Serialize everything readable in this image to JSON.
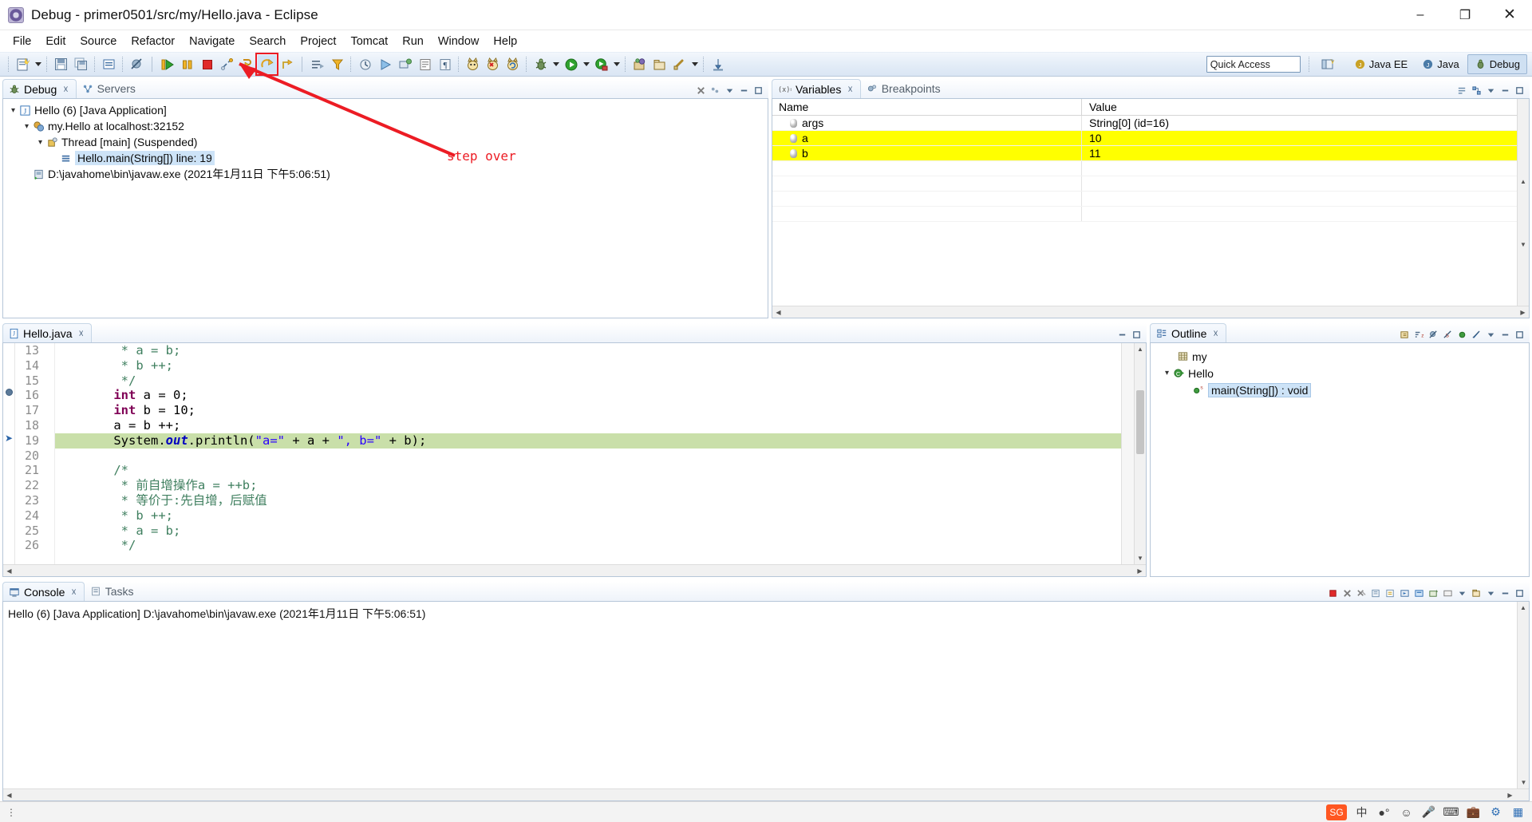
{
  "window": {
    "title": "Debug - primer0501/src/my/Hello.java - Eclipse",
    "app_icon": "eclipse-icon",
    "minimize": "–",
    "maximize": "❐",
    "close": "✕"
  },
  "menubar": {
    "items": [
      "File",
      "Edit",
      "Source",
      "Refactor",
      "Navigate",
      "Search",
      "Project",
      "Tomcat",
      "Run",
      "Window",
      "Help"
    ]
  },
  "toolbar": {
    "quick_access_placeholder": "Quick Access",
    "highlighted_tool": "step-over",
    "perspectives": [
      {
        "label": "Java EE",
        "icon": "java-ee-perspective-icon",
        "active": false
      },
      {
        "label": "Java",
        "icon": "java-perspective-icon",
        "active": false
      },
      {
        "label": "Debug",
        "icon": "debug-perspective-icon",
        "active": true
      }
    ]
  },
  "annotation": {
    "label": "step over",
    "color": "#ec1c24"
  },
  "debug_view": {
    "tabs": [
      {
        "label": "Debug",
        "icon": "debug-icon",
        "active": true,
        "closable": true
      },
      {
        "label": "Servers",
        "icon": "servers-icon",
        "active": false,
        "closable": false
      }
    ],
    "tree": [
      {
        "label": "Hello (6) [Java Application]",
        "icon": "launch-icon",
        "depth": 0,
        "expanded": true,
        "selected": false
      },
      {
        "label": "my.Hello at localhost:32152",
        "icon": "debug-target-icon",
        "depth": 1,
        "expanded": true,
        "selected": false
      },
      {
        "label": "Thread [main] (Suspended)",
        "icon": "thread-suspended-icon",
        "depth": 2,
        "expanded": true,
        "selected": false
      },
      {
        "label": "Hello.main(String[]) line: 19",
        "icon": "stack-frame-icon",
        "depth": 3,
        "expanded": null,
        "selected": true
      },
      {
        "label": "D:\\javahome\\bin\\javaw.exe (2021年1月11日 下午5:06:51)",
        "icon": "process-icon",
        "depth": 1,
        "expanded": null,
        "selected": false
      }
    ]
  },
  "variables_view": {
    "tabs": [
      {
        "label": "Variables",
        "icon": "variables-icon",
        "active": true,
        "closable": true
      },
      {
        "label": "Breakpoints",
        "icon": "breakpoints-icon",
        "active": false,
        "closable": false
      }
    ],
    "columns": [
      "Name",
      "Value"
    ],
    "rows": [
      {
        "name": "args",
        "value": "String[0]  (id=16)",
        "highlighted": false
      },
      {
        "name": "a",
        "value": "10",
        "highlighted": true
      },
      {
        "name": "b",
        "value": "11",
        "highlighted": true
      }
    ],
    "highlight_color": "#ffff00"
  },
  "editor": {
    "tab": {
      "label": "Hello.java",
      "icon": "java-file-icon",
      "closable": true
    },
    "first_line": 13,
    "current_line": 19,
    "breakpoint_line": 16,
    "lines": [
      {
        "n": 13,
        "tokens": [
          {
            "t": "        * a = b;",
            "c": "com"
          }
        ]
      },
      {
        "n": 14,
        "tokens": [
          {
            "t": "        * b ++;",
            "c": "com"
          }
        ]
      },
      {
        "n": 15,
        "tokens": [
          {
            "t": "        */",
            "c": "com"
          }
        ]
      },
      {
        "n": 16,
        "tokens": [
          {
            "t": "       ",
            "c": "txt"
          },
          {
            "t": "int",
            "c": "kw"
          },
          {
            "t": " a = 0;",
            "c": "txt"
          }
        ]
      },
      {
        "n": 17,
        "tokens": [
          {
            "t": "       ",
            "c": "txt"
          },
          {
            "t": "int",
            "c": "kw"
          },
          {
            "t": " b = 10;",
            "c": "txt"
          }
        ]
      },
      {
        "n": 18,
        "tokens": [
          {
            "t": "       a = b ++;",
            "c": "txt"
          }
        ]
      },
      {
        "n": 19,
        "tokens": [
          {
            "t": "       System.",
            "c": "txt"
          },
          {
            "t": "out",
            "c": "static"
          },
          {
            "t": ".println(",
            "c": "txt"
          },
          {
            "t": "\"a=\"",
            "c": "str"
          },
          {
            "t": " + a + ",
            "c": "txt"
          },
          {
            "t": "\", b=\"",
            "c": "str"
          },
          {
            "t": " + b);",
            "c": "txt"
          }
        ]
      },
      {
        "n": 20,
        "tokens": [
          {
            "t": "",
            "c": "txt"
          }
        ]
      },
      {
        "n": 21,
        "tokens": [
          {
            "t": "       /*",
            "c": "com"
          }
        ]
      },
      {
        "n": 22,
        "tokens": [
          {
            "t": "        * 前自增操作a = ++b;",
            "c": "com"
          }
        ]
      },
      {
        "n": 23,
        "tokens": [
          {
            "t": "        * 等价于:先自增，后赋值",
            "c": "com"
          }
        ]
      },
      {
        "n": 24,
        "tokens": [
          {
            "t": "        * b ++;",
            "c": "com"
          }
        ]
      },
      {
        "n": 25,
        "tokens": [
          {
            "t": "        * a = b;",
            "c": "com"
          }
        ]
      },
      {
        "n": 26,
        "tokens": [
          {
            "t": "        */",
            "c": "com"
          }
        ]
      }
    ]
  },
  "outline_view": {
    "tab": {
      "label": "Outline",
      "icon": "outline-icon",
      "closable": true
    },
    "items": [
      {
        "label": "my",
        "icon": "package-icon",
        "depth": 0,
        "expanded": null,
        "selected": false
      },
      {
        "label": "Hello",
        "icon": "class-icon",
        "depth": 0,
        "expanded": true,
        "selected": false
      },
      {
        "label": "main(String[]) : void",
        "icon": "public-static-method-icon",
        "depth": 1,
        "expanded": null,
        "selected": true
      }
    ]
  },
  "console_view": {
    "tabs": [
      {
        "label": "Console",
        "icon": "console-icon",
        "active": true,
        "closable": true
      },
      {
        "label": "Tasks",
        "icon": "tasks-icon",
        "active": false,
        "closable": false
      }
    ],
    "output": "Hello (6) [Java Application] D:\\javahome\\bin\\javaw.exe (2021年1月11日 下午5:06:51)"
  },
  "statusbar": {
    "ime": {
      "logo": "SG",
      "mode": "中",
      "icons": [
        "keyboard-mode-icon",
        "emoji-icon",
        "voice-input-icon",
        "keyboard-icon",
        "toolbox-icon",
        "settings-icon",
        "grid-icon"
      ]
    }
  }
}
